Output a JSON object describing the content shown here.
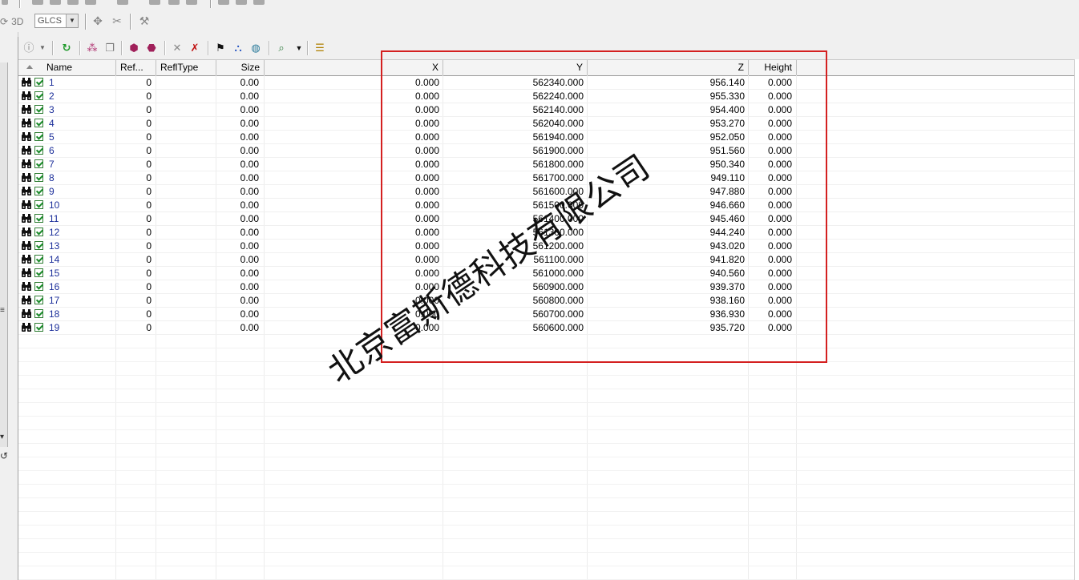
{
  "toolbar_top": {
    "label_3d": "3D",
    "coord_system": "GLCS"
  },
  "columns": [
    {
      "key": "name",
      "label": "Name"
    },
    {
      "key": "ref",
      "label": "Ref..."
    },
    {
      "key": "refltype",
      "label": "ReflType"
    },
    {
      "key": "size",
      "label": "Size"
    },
    {
      "key": "x",
      "label": "X"
    },
    {
      "key": "y",
      "label": "Y"
    },
    {
      "key": "z",
      "label": "Z"
    },
    {
      "key": "height",
      "label": "Height"
    }
  ],
  "rows": [
    {
      "name": "1",
      "ref": "0",
      "refltype": "",
      "size": "0.00",
      "x": "0.000",
      "y": "562340.000",
      "z": "956.140",
      "height": "0.000"
    },
    {
      "name": "2",
      "ref": "0",
      "refltype": "",
      "size": "0.00",
      "x": "0.000",
      "y": "562240.000",
      "z": "955.330",
      "height": "0.000"
    },
    {
      "name": "3",
      "ref": "0",
      "refltype": "",
      "size": "0.00",
      "x": "0.000",
      "y": "562140.000",
      "z": "954.400",
      "height": "0.000"
    },
    {
      "name": "4",
      "ref": "0",
      "refltype": "",
      "size": "0.00",
      "x": "0.000",
      "y": "562040.000",
      "z": "953.270",
      "height": "0.000"
    },
    {
      "name": "5",
      "ref": "0",
      "refltype": "",
      "size": "0.00",
      "x": "0.000",
      "y": "561940.000",
      "z": "952.050",
      "height": "0.000"
    },
    {
      "name": "6",
      "ref": "0",
      "refltype": "",
      "size": "0.00",
      "x": "0.000",
      "y": "561900.000",
      "z": "951.560",
      "height": "0.000"
    },
    {
      "name": "7",
      "ref": "0",
      "refltype": "",
      "size": "0.00",
      "x": "0.000",
      "y": "561800.000",
      "z": "950.340",
      "height": "0.000"
    },
    {
      "name": "8",
      "ref": "0",
      "refltype": "",
      "size": "0.00",
      "x": "0.000",
      "y": "561700.000",
      "z": "949.110",
      "height": "0.000"
    },
    {
      "name": "9",
      "ref": "0",
      "refltype": "",
      "size": "0.00",
      "x": "0.000",
      "y": "561600.000",
      "z": "947.880",
      "height": "0.000"
    },
    {
      "name": "10",
      "ref": "0",
      "refltype": "",
      "size": "0.00",
      "x": "0.000",
      "y": "561500.000",
      "z": "946.660",
      "height": "0.000"
    },
    {
      "name": "11",
      "ref": "0",
      "refltype": "",
      "size": "0.00",
      "x": "0.000",
      "y": "561400.000",
      "z": "945.460",
      "height": "0.000"
    },
    {
      "name": "12",
      "ref": "0",
      "refltype": "",
      "size": "0.00",
      "x": "0.000",
      "y": "561300.000",
      "z": "944.240",
      "height": "0.000"
    },
    {
      "name": "13",
      "ref": "0",
      "refltype": "",
      "size": "0.00",
      "x": "0.000",
      "y": "561200.000",
      "z": "943.020",
      "height": "0.000"
    },
    {
      "name": "14",
      "ref": "0",
      "refltype": "",
      "size": "0.00",
      "x": "0.000",
      "y": "561100.000",
      "z": "941.820",
      "height": "0.000"
    },
    {
      "name": "15",
      "ref": "0",
      "refltype": "",
      "size": "0.00",
      "x": "0.000",
      "y": "561000.000",
      "z": "940.560",
      "height": "0.000"
    },
    {
      "name": "16",
      "ref": "0",
      "refltype": "",
      "size": "0.00",
      "x": "0.000",
      "y": "560900.000",
      "z": "939.370",
      "height": "0.000"
    },
    {
      "name": "17",
      "ref": "0",
      "refltype": "",
      "size": "0.00",
      "x": "0.000",
      "y": "560800.000",
      "z": "938.160",
      "height": "0.000"
    },
    {
      "name": "18",
      "ref": "0",
      "refltype": "",
      "size": "0.00",
      "x": "0.000",
      "y": "560700.000",
      "z": "936.930",
      "height": "0.000"
    },
    {
      "name": "19",
      "ref": "0",
      "refltype": "",
      "size": "0.00",
      "x": "0.000",
      "y": "560600.000",
      "z": "935.720",
      "height": "0.000"
    }
  ],
  "watermark": "北京富斯德科技有限公司",
  "colors": {
    "highlight_box": "#d42020",
    "name_text": "#1c2f9a",
    "checkbox": "#1b8a2a"
  }
}
